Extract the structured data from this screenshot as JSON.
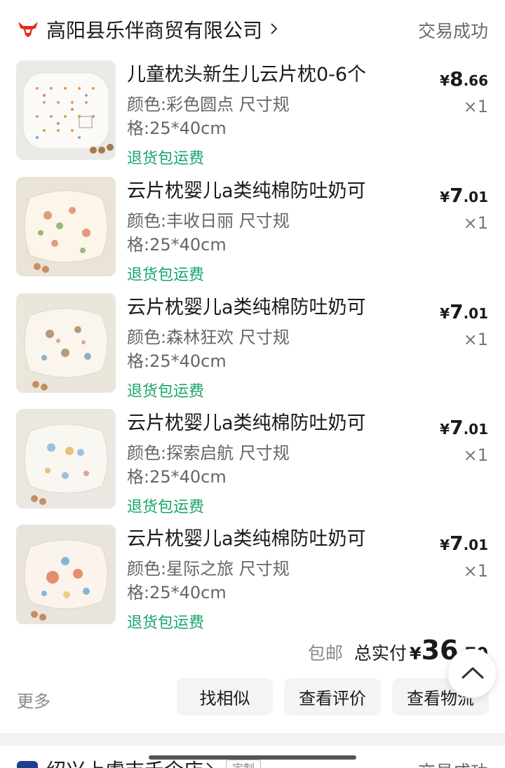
{
  "shop": {
    "name": "高阳县乐伴商贸有限公司",
    "status": "交易成功",
    "logo_icon": "bull-logo-icon",
    "accent_color": "#e8291c"
  },
  "items": [
    {
      "title": "儿童枕头新生儿云片枕0-6个",
      "spec_line1": "颜色:彩色圆点 尺寸规",
      "spec_line2": "格:25*40cm",
      "tag": "退货包运费",
      "price_symbol": "¥",
      "price_int": "8",
      "price_dec": ".66",
      "qty": "×1",
      "thumb_label": "彩色圆点"
    },
    {
      "title": "云片枕婴儿a类纯棉防吐奶可",
      "spec_line1": "颜色:丰收日丽 尺寸规",
      "spec_line2": "格:25*40cm",
      "tag": "退货包运费",
      "price_symbol": "¥",
      "price_int": "7",
      "price_dec": ".01",
      "qty": "×1",
      "thumb_label": "丰收日丽"
    },
    {
      "title": "云片枕婴儿a类纯棉防吐奶可",
      "spec_line1": "颜色:森林狂欢 尺寸规",
      "spec_line2": "格:25*40cm",
      "tag": "退货包运费",
      "price_symbol": "¥",
      "price_int": "7",
      "price_dec": ".01",
      "qty": "×1",
      "thumb_label": "森林狂欢"
    },
    {
      "title": "云片枕婴儿a类纯棉防吐奶可",
      "spec_line1": "颜色:探索启航 尺寸规",
      "spec_line2": "格:25*40cm",
      "tag": "退货包运费",
      "price_symbol": "¥",
      "price_int": "7",
      "price_dec": ".01",
      "qty": "×1",
      "thumb_label": "探索启航"
    },
    {
      "title": "云片枕婴儿a类纯棉防吐奶可",
      "spec_line1": "颜色:星际之旅 尺寸规",
      "spec_line2": "格:25*40cm",
      "tag": "退货包运费",
      "price_symbol": "¥",
      "price_int": "7",
      "price_dec": ".01",
      "qty": "×1",
      "thumb_label": "星际之旅"
    }
  ],
  "summary": {
    "free_shipping": "包邮",
    "total_label": "总实付",
    "total_symbol": "¥",
    "total_int": "36",
    "total_dec": ".70"
  },
  "actions": {
    "more": "更多",
    "find_similar": "找相似",
    "view_review": "查看评价",
    "view_logistics": "查看物流"
  },
  "next_order": {
    "shop_name": "绍兴上虞吉禾企店",
    "badge": "定制",
    "status": "交易成功"
  },
  "colors": {
    "tag_green": "#1aa56b",
    "button_bg": "#f4f4f4",
    "muted_text": "#8a8a8a"
  }
}
